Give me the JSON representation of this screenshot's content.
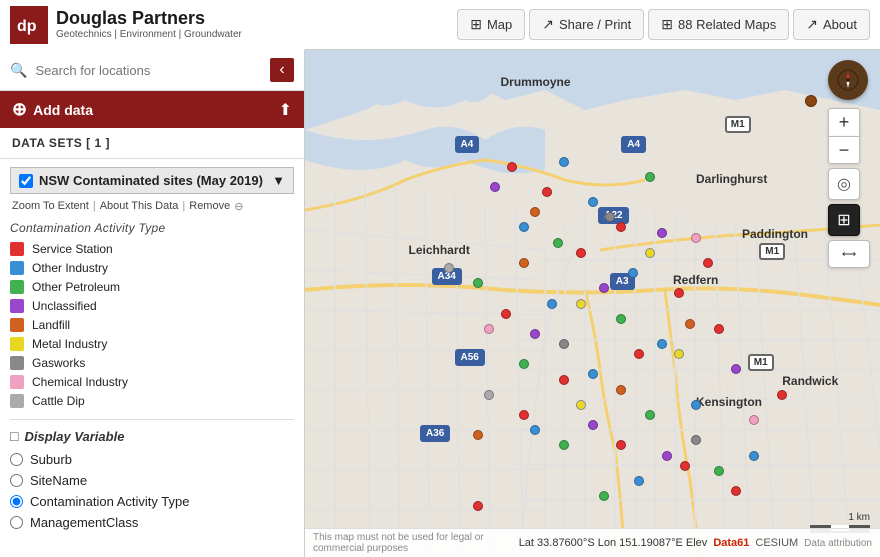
{
  "header": {
    "logo_initials": "dp",
    "company_name": "Douglas Partners",
    "tagline": "Geotechnics  |  Environment  |  Groundwater",
    "nav": {
      "map_label": "Map",
      "share_label": "Share / Print",
      "related_maps_label": "88 Related Maps",
      "about_label": "About"
    }
  },
  "sidebar": {
    "search_placeholder": "Search for locations",
    "add_data_label": "Add data",
    "datasets_header": "DATA SETS [ 1 ]",
    "dataset": {
      "title": "NSW Contaminated sites (May 2019)",
      "actions": {
        "zoom": "Zoom To Extent",
        "about": "About This Data",
        "remove": "Remove"
      },
      "legend_header": "Contamination Activity Type",
      "legend_items": [
        {
          "label": "Service Station",
          "color": "#e03030"
        },
        {
          "label": "Other Industry",
          "color": "#3a8fd4"
        },
        {
          "label": "Other Petroleum",
          "color": "#40b050"
        },
        {
          "label": "Unclassified",
          "color": "#9945cc"
        },
        {
          "label": "Landfill",
          "color": "#d06020"
        },
        {
          "label": "Metal Industry",
          "color": "#e8d820"
        },
        {
          "label": "Gasworks",
          "color": "#888888"
        },
        {
          "label": "Chemical Industry",
          "color": "#f0a0c0"
        },
        {
          "label": "Cattle Dip",
          "color": "#aaaaaa"
        }
      ]
    },
    "display_variable": {
      "header": "Display Variable",
      "options": [
        {
          "label": "Suburb",
          "checked": false
        },
        {
          "label": "SiteName",
          "checked": false
        },
        {
          "label": "Contamination Activity Type",
          "checked": true
        },
        {
          "label": "ManagementClass",
          "checked": false
        }
      ]
    }
  },
  "map": {
    "suburb_labels": [
      {
        "label": "Drummoyne",
        "top": "5%",
        "left": "34%"
      },
      {
        "label": "Darlinghurst",
        "top": "24%",
        "left": "72%"
      },
      {
        "label": "Paddington",
        "top": "35%",
        "left": "78%"
      },
      {
        "label": "Leichhardt",
        "top": "38%",
        "left": "25%"
      },
      {
        "label": "Redfern",
        "top": "45%",
        "left": "66%"
      },
      {
        "label": "Kensington",
        "top": "68%",
        "left": "72%"
      },
      {
        "label": "Randwick",
        "top": "65%",
        "left": "86%"
      }
    ],
    "route_badges": [
      {
        "label": "A4",
        "top": "18%",
        "left": "27%",
        "style": "blue-bg"
      },
      {
        "label": "A4",
        "top": "18%",
        "left": "58%",
        "style": "blue-bg"
      },
      {
        "label": "M1",
        "top": "15%",
        "left": "74%",
        "style": ""
      },
      {
        "label": "M1",
        "top": "40%",
        "left": "80%",
        "style": ""
      },
      {
        "label": "M1",
        "top": "60%",
        "left": "78%",
        "style": ""
      },
      {
        "label": "A22",
        "top": "32%",
        "left": "53%",
        "style": "blue-bg"
      },
      {
        "label": "A3",
        "top": "46%",
        "left": "55%",
        "style": "blue-bg"
      },
      {
        "label": "A34",
        "top": "44%",
        "left": "24%",
        "style": "blue-bg"
      },
      {
        "label": "A56",
        "top": "60%",
        "left": "28%",
        "style": "blue-bg"
      },
      {
        "label": "A36",
        "top": "75%",
        "left": "22%",
        "style": "blue-bg"
      }
    ],
    "statusbar": {
      "warning": "This map must not be used for legal or commercial purposes",
      "coords": "Lat  33.87600°S  Lon  151.19087°E  Elev",
      "data61": "Data61",
      "cesium": "CESIUM",
      "attribution": "Data attribution"
    },
    "scale_label": "1 km",
    "controls": {
      "zoom_in": "+",
      "zoom_out": "−",
      "compass": "⊕",
      "locate": "◎",
      "layers": "⊞",
      "distance": "⟷"
    }
  }
}
